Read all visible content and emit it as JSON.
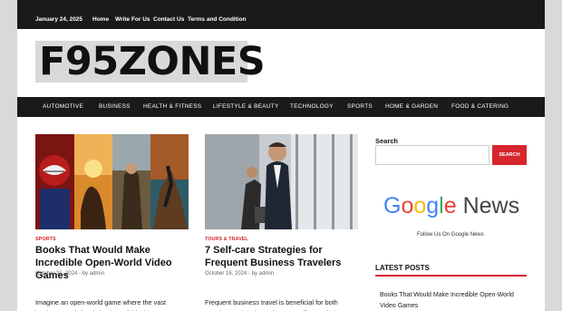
{
  "topbar": {
    "date": "January 24, 2025",
    "links": [
      "Home",
      "Write For Us",
      "Contact Us",
      "Terms and Condition"
    ]
  },
  "logo": {
    "text": "F95ZONES"
  },
  "nav": {
    "items": [
      "AUTOMOTIVE",
      "BUSINESS",
      "HEALTH & FITNESS",
      "LIFESTYLE & BEAUTY",
      "TECHNOLOGY",
      "SPORTS",
      "HOME & GARDEN",
      "FOOD & CATERING"
    ]
  },
  "posts": [
    {
      "category": "SPORTS",
      "title": "Books That Would Make Incredible Open-World Video Games",
      "date": "October 31, 2024",
      "author_prefix": "by",
      "author": "admin",
      "excerpt": "Imagine an open-world game where the vast landscapes of classic books unfold with every step"
    },
    {
      "category": "TOURS & TRAVEL",
      "title": "7 Self-care Strategies for Frequent Business Travelers",
      "date": "October 16, 2024",
      "author_prefix": "by",
      "author": "admin",
      "excerpt": "Frequent business travel is beneficial for both travelers and their employers.  It offers a plethora"
    }
  ],
  "sidebar": {
    "search_label": "Search",
    "search_placeholder": "",
    "search_button": "SEARCH",
    "google_news": {
      "google": "Google",
      "news": "News"
    },
    "follow_text": "Follow Us On Google News",
    "latest_title": "LATEST POSTS",
    "latest_items": [
      "Books That Would Make Incredible Open-World Video Games"
    ]
  },
  "colors": {
    "accent": "#d7262d",
    "dark": "#1a1a1a"
  }
}
